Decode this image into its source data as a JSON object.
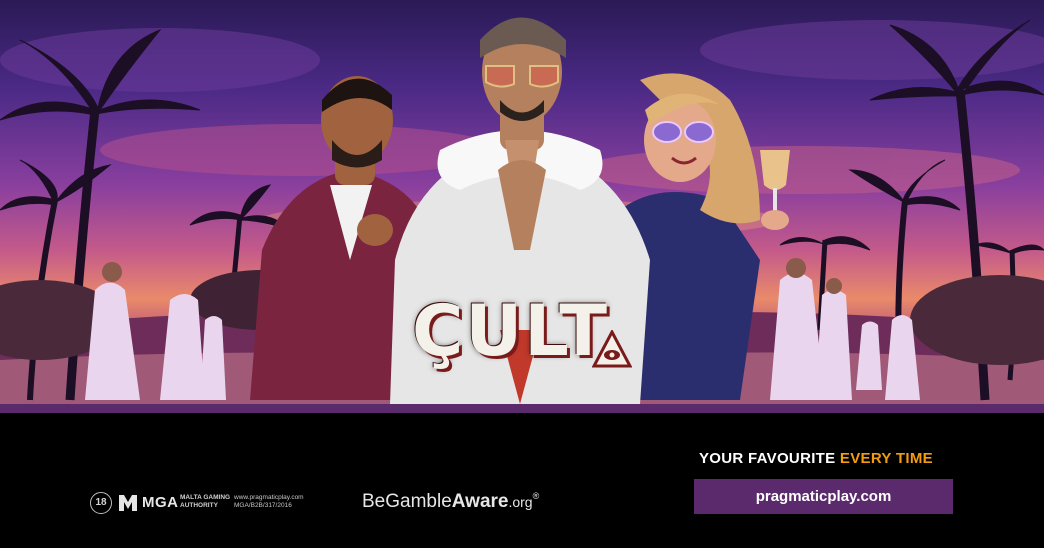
{
  "game": {
    "logo_text": "ÇULT"
  },
  "footer": {
    "age_badge": "18",
    "mga_label": "MGA",
    "mga_authority_line1": "MALTA GAMING",
    "mga_authority_line2": "AUTHORITY",
    "mga_url": "www.pragmaticplay.com",
    "mga_license": "MGA/B2B/317/2016",
    "gamble_aware_be": "Be",
    "gamble_aware_gamble": "Gamble",
    "gamble_aware_aware": "Aware",
    "gamble_aware_org": ".org",
    "gamble_aware_reg": "®",
    "tagline_main": "YOUR FAVOURITE",
    "tagline_accent": "EVERY TIME",
    "site_button_label": "pragmaticplay.com"
  },
  "colors": {
    "footer_background": "#000000",
    "button_background": "#5b2a6d",
    "accent_orange": "#f39c12",
    "sky_purple": "#8a3f9e",
    "sunset_pink": "#e98a6a"
  },
  "icons": {
    "age": "age-18-icon",
    "mga": "mga-logo-icon",
    "eye": "eye-triangle-icon"
  }
}
